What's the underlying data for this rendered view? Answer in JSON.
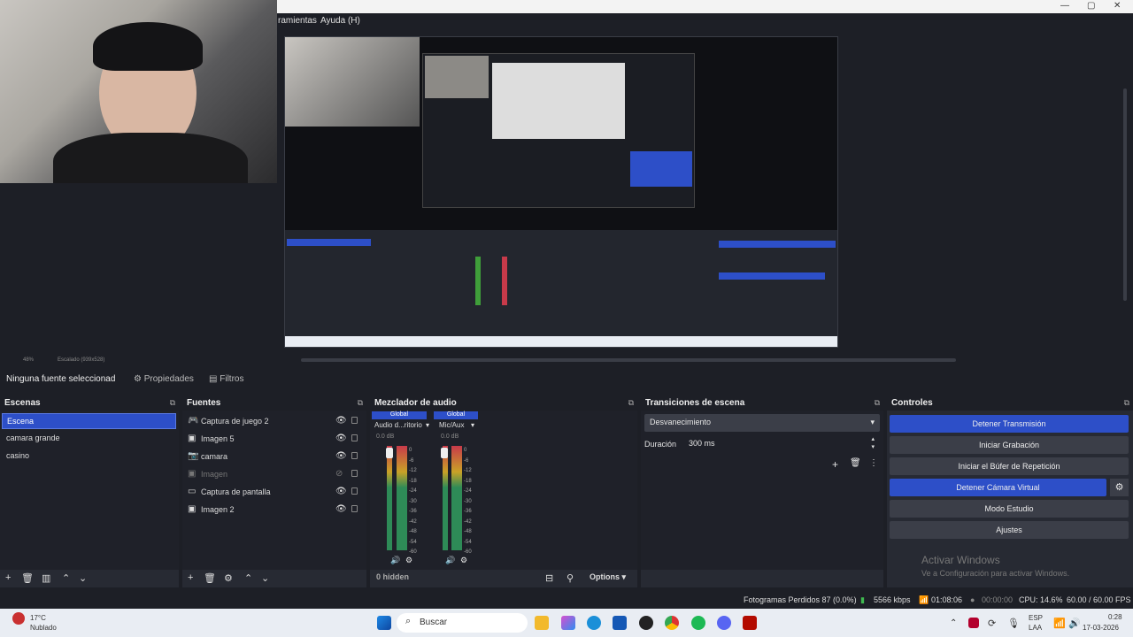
{
  "menu": {
    "herramientas": "ramientas",
    "ayuda": "Ayuda (H)"
  },
  "window_controls": {
    "minimize": "—",
    "restore": "▢",
    "close": "✕"
  },
  "preview_bar": {
    "zoom": "48%",
    "scale": "Escalado (939x528)"
  },
  "propbar": {
    "no_source": "Ninguna fuente seleccionad",
    "properties": "Propiedades",
    "filters": "Filtros"
  },
  "scenes": {
    "title": "Escenas",
    "items": [
      "Escena",
      "camara grande",
      "casino"
    ],
    "selected_index": 0
  },
  "sources": {
    "title": "Fuentes",
    "items": [
      {
        "label": "Captura de juego 2",
        "icon": "gamepad-icon",
        "visible": true
      },
      {
        "label": "Imagen 5",
        "icon": "image-icon",
        "visible": true
      },
      {
        "label": "camara",
        "icon": "camera-icon",
        "visible": true
      },
      {
        "label": "Imagen",
        "icon": "image-icon",
        "visible": false
      },
      {
        "label": "Captura de pantalla",
        "icon": "monitor-icon",
        "visible": true
      },
      {
        "label": "Imagen 2",
        "icon": "image-icon",
        "visible": true
      }
    ]
  },
  "mixer": {
    "title": "Mezclador de audio",
    "channels": [
      {
        "name": "Audio d...ritorio",
        "tag": "Global",
        "db": "0.0 dB"
      },
      {
        "name": "Mic/Aux",
        "tag": "Global",
        "db": "0.0 dB"
      }
    ],
    "ticks": [
      "0",
      "-6",
      "-12",
      "-18",
      "-24",
      "-30",
      "-36",
      "-42",
      "-48",
      "-54",
      "-60"
    ],
    "hidden": "0 hidden",
    "options": "Options"
  },
  "transitions": {
    "title": "Transiciones de escena",
    "selected": "Desvanecimiento",
    "duration_label": "Duración",
    "duration_value": "300 ms"
  },
  "controls": {
    "title": "Controles",
    "buttons": [
      {
        "label": "Detener Transmisión",
        "active": true
      },
      {
        "label": "Iniciar Grabación",
        "active": false
      },
      {
        "label": "Iniciar el Búfer de Repetición",
        "active": false
      },
      {
        "label": "Detener Cámara Virtual",
        "active": true
      },
      {
        "label": "Modo Estudio",
        "active": false
      },
      {
        "label": "Ajustes",
        "active": false
      }
    ],
    "watermark_title": "Activar Windows",
    "watermark_sub": "Ve a Configuración para activar Windows."
  },
  "status": {
    "dropped": "Fotogramas Perdidos 87 (0.0%)",
    "kbps": "5566 kbps",
    "stream_time": "01:08:06",
    "rec_time": "00:00:00",
    "cpu": "CPU: 14.6%",
    "fps": "60.00 / 60.00 FPS"
  },
  "taskbar": {
    "weather_temp": "17°C",
    "weather_desc": "Nublado",
    "search": "Buscar",
    "lang_top": "ESP",
    "lang_bottom": "LAA",
    "time": "0:28",
    "date": "17-03-2026"
  },
  "colors": {
    "accent": "#2d4fc8",
    "bg": "#1d1f26",
    "panel": "#272a33"
  }
}
